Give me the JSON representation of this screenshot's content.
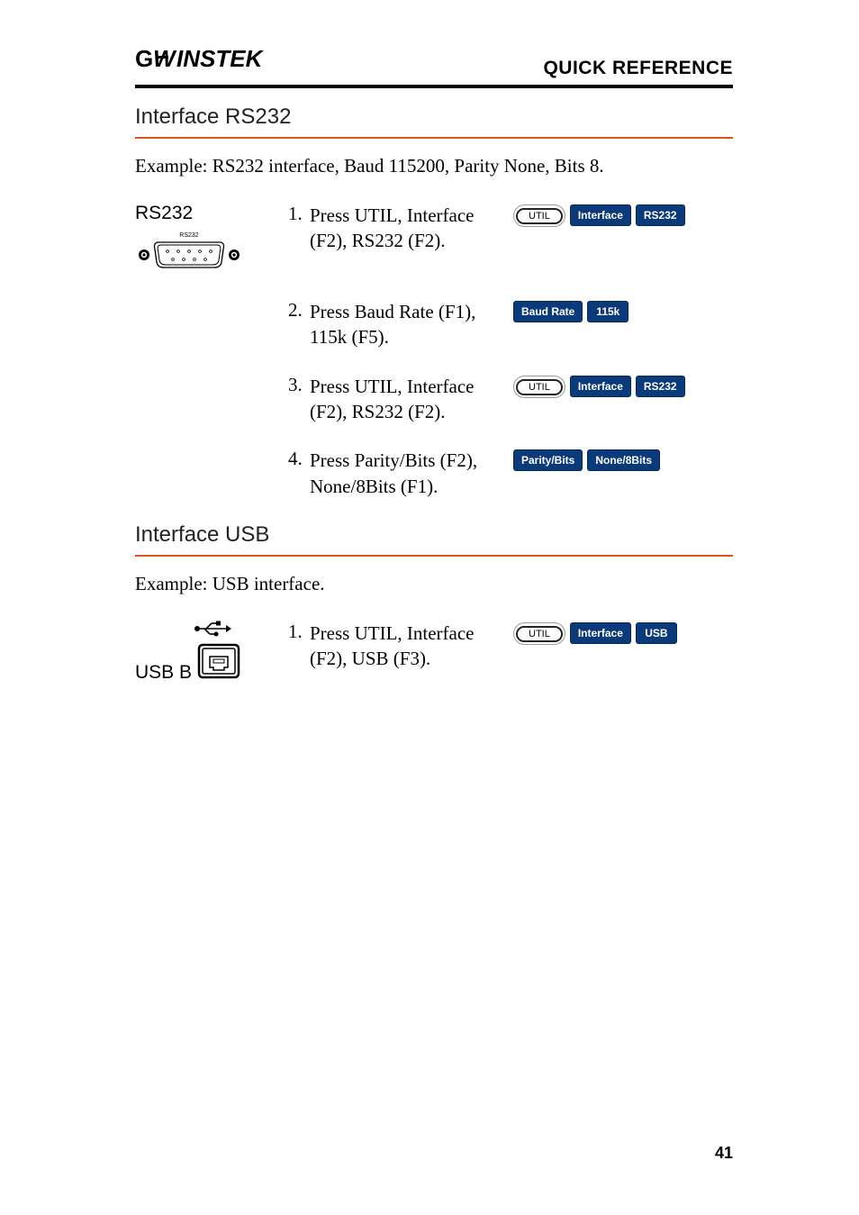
{
  "header": {
    "right": "QUICK REFERENCE"
  },
  "section1": {
    "title": "Interface RS232",
    "example": "Example: RS232 interface, Baud 115200, Parity None, Bits 8.",
    "leftLabel": "RS232",
    "connLabel": "RS232",
    "steps": [
      {
        "num": "1.",
        "text": "Press UTIL, Interface (F2), RS232 (F2).",
        "buttons": [
          {
            "type": "oval",
            "label": "UTIL"
          },
          {
            "type": "blue",
            "label": "Interface"
          },
          {
            "type": "blue",
            "label": "RS232"
          }
        ]
      },
      {
        "num": "2.",
        "text": "Press Baud Rate (F1), 115k (F5).",
        "buttons": [
          {
            "type": "blue",
            "label": "Baud Rate"
          },
          {
            "type": "blue",
            "label": "115k"
          }
        ]
      },
      {
        "num": "3.",
        "text": "Press UTIL, Interface (F2), RS232 (F2).",
        "buttons": [
          {
            "type": "oval",
            "label": "UTIL"
          },
          {
            "type": "blue",
            "label": "Interface"
          },
          {
            "type": "blue",
            "label": "RS232"
          }
        ]
      },
      {
        "num": "4.",
        "text": "Press Parity/Bits (F2), None/8Bits (F1).",
        "buttons": [
          {
            "type": "blue",
            "label": "Parity/Bits"
          },
          {
            "type": "blue",
            "label": "None/8Bits"
          }
        ]
      }
    ]
  },
  "section2": {
    "title": "Interface USB",
    "example": "Example: USB interface.",
    "leftLabel": "USB B",
    "steps": [
      {
        "num": "1.",
        "text": "Press UTIL, Interface (F2), USB (F3).",
        "buttons": [
          {
            "type": "oval",
            "label": "UTIL"
          },
          {
            "type": "blue",
            "label": "Interface"
          },
          {
            "type": "blue",
            "label": "USB"
          }
        ]
      }
    ]
  },
  "pageNum": "41"
}
